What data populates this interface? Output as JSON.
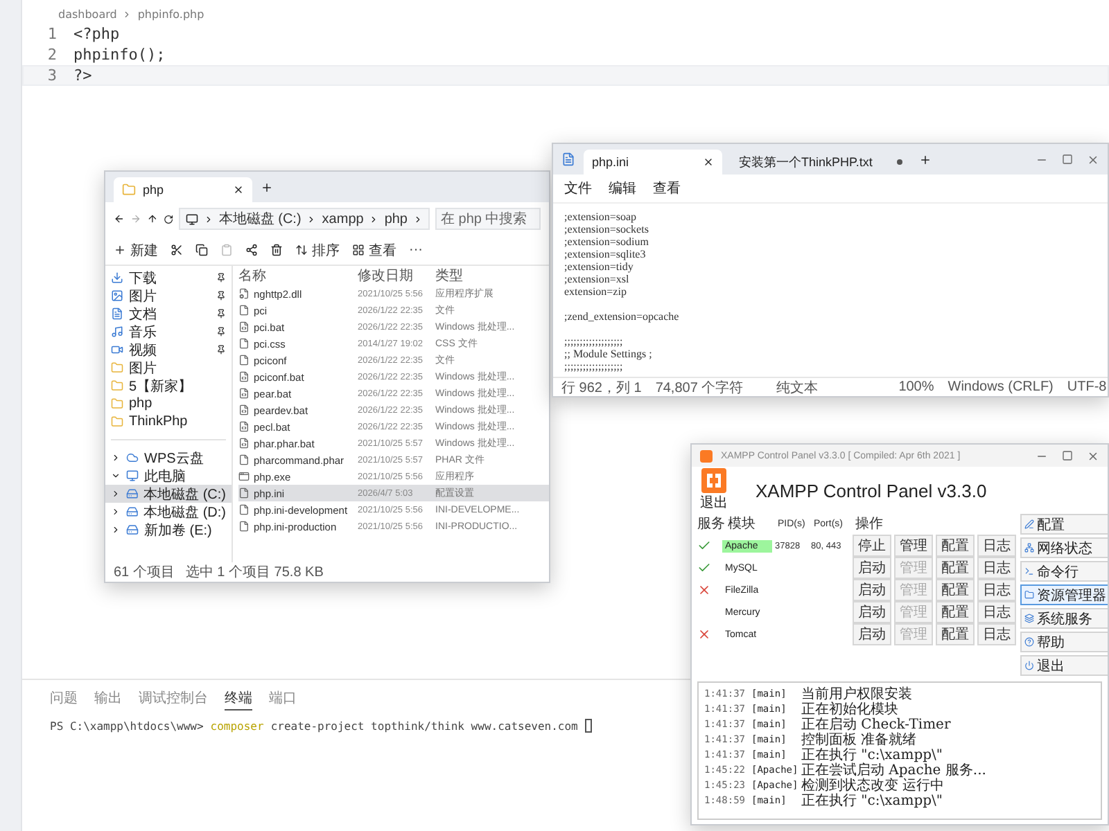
{
  "editor": {
    "breadcrumb": [
      "dashboard",
      "phpinfo.php"
    ],
    "lines": [
      {
        "number": "1",
        "code": "<?php",
        "selected": false
      },
      {
        "number": "2",
        "code": "phpinfo();",
        "selected": false
      },
      {
        "number": "3",
        "code": "?>",
        "selected": true
      }
    ]
  },
  "panel": {
    "tabs": [
      {
        "label": "问题",
        "selected": false
      },
      {
        "label": "输出",
        "selected": false
      },
      {
        "label": "调试控制台",
        "selected": false
      },
      {
        "label": "终端",
        "selected": true
      },
      {
        "label": "端口",
        "selected": false
      }
    ],
    "terminal": {
      "prompt": "PS C:\\xampp\\htdocs\\www>",
      "program": "composer",
      "args": "create-project topthink/think www.catseven.com"
    }
  },
  "explorer": {
    "tab_title": "php",
    "address": [
      "本地磁盘 (C:)",
      "xampp",
      "php"
    ],
    "search": {
      "placeholder": "在 php 中搜索"
    },
    "toolbar": {
      "new": "新建",
      "sort": "排序",
      "view": "查看",
      "more": "···"
    },
    "quick_access": [
      {
        "label": "下载",
        "kind": "download",
        "pinned": true
      },
      {
        "label": "图片",
        "kind": "pictures",
        "pinned": true
      },
      {
        "label": "文档",
        "kind": "documents",
        "pinned": true
      },
      {
        "label": "音乐",
        "kind": "music",
        "pinned": true
      },
      {
        "label": "视频",
        "kind": "videos",
        "pinned": true
      },
      {
        "label": "图片",
        "kind": "folder",
        "pinned": false
      },
      {
        "label": "5【新家】",
        "kind": "folder",
        "pinned": false
      },
      {
        "label": "php",
        "kind": "folder",
        "pinned": false
      },
      {
        "label": "ThinkPhp",
        "kind": "folder",
        "pinned": false
      }
    ],
    "tree": [
      {
        "label": "WPS云盘",
        "kind": "cloud",
        "expanded": false,
        "selected": false
      },
      {
        "label": "此电脑",
        "kind": "pc",
        "expanded": true,
        "selected": false
      },
      {
        "label": "本地磁盘 (C:)",
        "kind": "drive",
        "expanded": false,
        "selected": true
      },
      {
        "label": "本地磁盘 (D:)",
        "kind": "drive",
        "expanded": false,
        "selected": false
      },
      {
        "label": "新加卷 (E:)",
        "kind": "drive",
        "expanded": false,
        "selected": false
      }
    ],
    "columns": [
      "名称",
      "修改日期",
      "类型"
    ],
    "rows": [
      {
        "name": "nghttp2.dll",
        "date": "2021/10/25 5:56",
        "type": "应用程序扩展",
        "kind": "dll",
        "selected": false
      },
      {
        "name": "pci",
        "date": "2026/1/22 22:35",
        "type": "文件",
        "kind": "file",
        "selected": false
      },
      {
        "name": "pci.bat",
        "date": "2026/1/22 22:35",
        "type": "Windows 批处理...",
        "kind": "bat",
        "selected": false
      },
      {
        "name": "pci.css",
        "date": "2014/1/27 19:02",
        "type": "CSS 文件",
        "kind": "file",
        "selected": false
      },
      {
        "name": "pciconf",
        "date": "2026/1/22 22:35",
        "type": "文件",
        "kind": "file",
        "selected": false
      },
      {
        "name": "pciconf.bat",
        "date": "2026/1/22 22:35",
        "type": "Windows 批处理...",
        "kind": "bat",
        "selected": false
      },
      {
        "name": "pear.bat",
        "date": "2026/1/22 22:35",
        "type": "Windows 批处理...",
        "kind": "bat",
        "selected": false
      },
      {
        "name": "peardev.bat",
        "date": "2026/1/22 22:35",
        "type": "Windows 批处理...",
        "kind": "bat",
        "selected": false
      },
      {
        "name": "pecl.bat",
        "date": "2026/1/22 22:35",
        "type": "Windows 批处理...",
        "kind": "bat",
        "selected": false
      },
      {
        "name": "phar.phar.bat",
        "date": "2021/10/25 5:57",
        "type": "Windows 批处理...",
        "kind": "bat",
        "selected": false
      },
      {
        "name": "pharcommand.phar",
        "date": "2021/10/25 5:57",
        "type": "PHAR 文件",
        "kind": "file",
        "selected": false
      },
      {
        "name": "php.exe",
        "date": "2021/10/25 5:56",
        "type": "应用程序",
        "kind": "exe",
        "selected": false
      },
      {
        "name": "php.ini",
        "date": "2026/4/7 5:03",
        "type": "配置设置",
        "kind": "file",
        "selected": true
      },
      {
        "name": "php.ini-development",
        "date": "2021/10/25 5:56",
        "type": "INI-DEVELOPME...",
        "kind": "file",
        "selected": false
      },
      {
        "name": "php.ini-production",
        "date": "2021/10/25 5:56",
        "type": "INI-PRODUCTIO...",
        "kind": "file",
        "selected": false
      }
    ],
    "status": [
      "61 个项目",
      "选中 1 个项目 75.8 KB"
    ]
  },
  "notepad": {
    "tabs": [
      {
        "label": "php.ini",
        "selected": true,
        "modified": false
      },
      {
        "label": "安装第一个ThinkPHP.txt",
        "selected": false,
        "modified": true
      }
    ],
    "menu": [
      "文件",
      "编辑",
      "查看"
    ],
    "blocks": [
      [
        ";extension=soap",
        ";extension=sockets",
        ";extension=sodium",
        ";extension=sqlite3",
        ";extension=tidy",
        ";extension=xsl",
        "extension=zip"
      ],
      [
        ";zend_extension=opcache"
      ],
      [
        ";;;;;;;;;;;;;;;;;;;",
        ";; Module Settings ;",
        ";;;;;;;;;;;;;;;;;;;"
      ]
    ],
    "status": [
      "行 962，列 1",
      "74,807 个字符",
      "纯文本",
      "100%",
      "Windows (CRLF)",
      "UTF-8"
    ]
  },
  "xampp": {
    "title": "XAMPP Control Panel v3.3.0  [ Compiled: Apr 6th 2021 ]",
    "heading": "XAMPP Control Panel v3.3.0",
    "logo_label": "退出",
    "columns": [
      "服务",
      "模块",
      "PID(s)",
      "Port(s)",
      "操作"
    ],
    "services": [
      {
        "kind": "check",
        "module": "Apache",
        "running": true,
        "pid": "37828",
        "ports": "80, 443",
        "actions": [
          {
            "label": "停止",
            "disabled": false
          },
          {
            "label": "管理",
            "disabled": false
          },
          {
            "label": "配置",
            "disabled": false
          },
          {
            "label": "日志",
            "disabled": false
          }
        ]
      },
      {
        "kind": "check",
        "module": "MySQL",
        "running": false,
        "actions": [
          {
            "label": "启动",
            "disabled": false
          },
          {
            "label": "管理",
            "disabled": true
          },
          {
            "label": "配置",
            "disabled": false
          },
          {
            "label": "日志",
            "disabled": false
          }
        ]
      },
      {
        "kind": "cross",
        "module": "FileZilla",
        "running": false,
        "actions": [
          {
            "label": "启动",
            "disabled": false
          },
          {
            "label": "管理",
            "disabled": true
          },
          {
            "label": "配置",
            "disabled": false
          },
          {
            "label": "日志",
            "disabled": false
          }
        ]
      },
      {
        "kind": "blank",
        "module": "Mercury",
        "running": false,
        "actions": [
          {
            "label": "启动",
            "disabled": false
          },
          {
            "label": "管理",
            "disabled": true
          },
          {
            "label": "配置",
            "disabled": false
          },
          {
            "label": "日志",
            "disabled": false
          }
        ]
      },
      {
        "kind": "cross",
        "module": "Tomcat",
        "running": false,
        "actions": [
          {
            "label": "启动",
            "disabled": false
          },
          {
            "label": "管理",
            "disabled": true
          },
          {
            "label": "配置",
            "disabled": false
          },
          {
            "label": "日志",
            "disabled": false
          }
        ]
      }
    ],
    "side_buttons": [
      {
        "label": "配置",
        "kind": "config",
        "selected": false
      },
      {
        "label": "网络状态",
        "kind": "network",
        "selected": false
      },
      {
        "label": "命令行",
        "kind": "shell",
        "selected": false
      },
      {
        "label": "资源管理器",
        "kind": "folder",
        "selected": true
      },
      {
        "label": "系统服务",
        "kind": "services",
        "selected": false
      },
      {
        "label": "帮助",
        "kind": "help",
        "selected": false
      },
      {
        "label": "退出",
        "kind": "quit",
        "selected": false
      }
    ],
    "log": [
      {
        "time": "1:41:37",
        "source": "[main]",
        "message": "当前用户权限安装"
      },
      {
        "time": "1:41:37",
        "source": "[main]",
        "message": "正在初始化模块"
      },
      {
        "time": "1:41:37",
        "source": "[main]",
        "message": "正在启动 Check-Timer"
      },
      {
        "time": "1:41:37",
        "source": "[main]",
        "message": "控制面板 准备就绪"
      },
      {
        "time": "1:41:37",
        "source": "[main]",
        "message": "正在执行 \"c:\\xampp\\\""
      },
      {
        "time": "1:45:22",
        "source": "[Apache]",
        "message": "正在尝试启动 Apache 服务..."
      },
      {
        "time": "1:45:23",
        "source": "[Apache]",
        "message": "检测到状态改变 运行中"
      },
      {
        "time": "1:48:59",
        "source": "[main]",
        "message": "正在执行 \"c:\\xampp\\\""
      }
    ]
  }
}
